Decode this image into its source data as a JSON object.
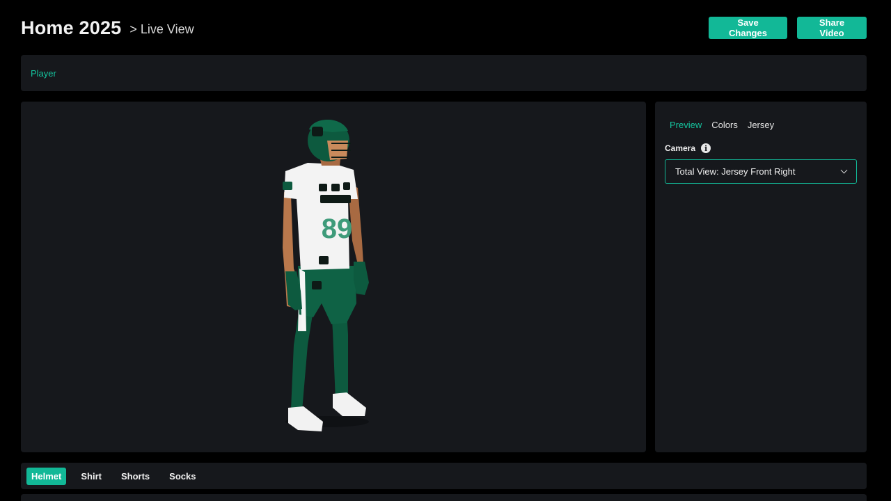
{
  "header": {
    "title": "Home 2025",
    "breadcrumb": "> Live View"
  },
  "actions": {
    "save_label": "Save Changes",
    "share_label": "Share Video"
  },
  "player_bar": {
    "label": "Player"
  },
  "viewport": {
    "jersey_number": "89"
  },
  "panel": {
    "tabs": [
      {
        "label": "Preview",
        "active": true
      },
      {
        "label": "Colors",
        "active": false
      },
      {
        "label": "Jersey",
        "active": false
      }
    ],
    "camera_label": "Camera",
    "camera_info_icon": "info-icon",
    "camera_value": "Total View: Jersey Front Right"
  },
  "bottom_tabs": [
    {
      "label": "Helmet",
      "active": true
    },
    {
      "label": "Shirt",
      "active": false
    },
    {
      "label": "Shorts",
      "active": false
    },
    {
      "label": "Socks",
      "active": false
    }
  ],
  "colors": {
    "accent": "#12b897",
    "panel_bg": "#16181c",
    "page_bg": "#000000",
    "uniform_green": "#0d5a3f"
  }
}
